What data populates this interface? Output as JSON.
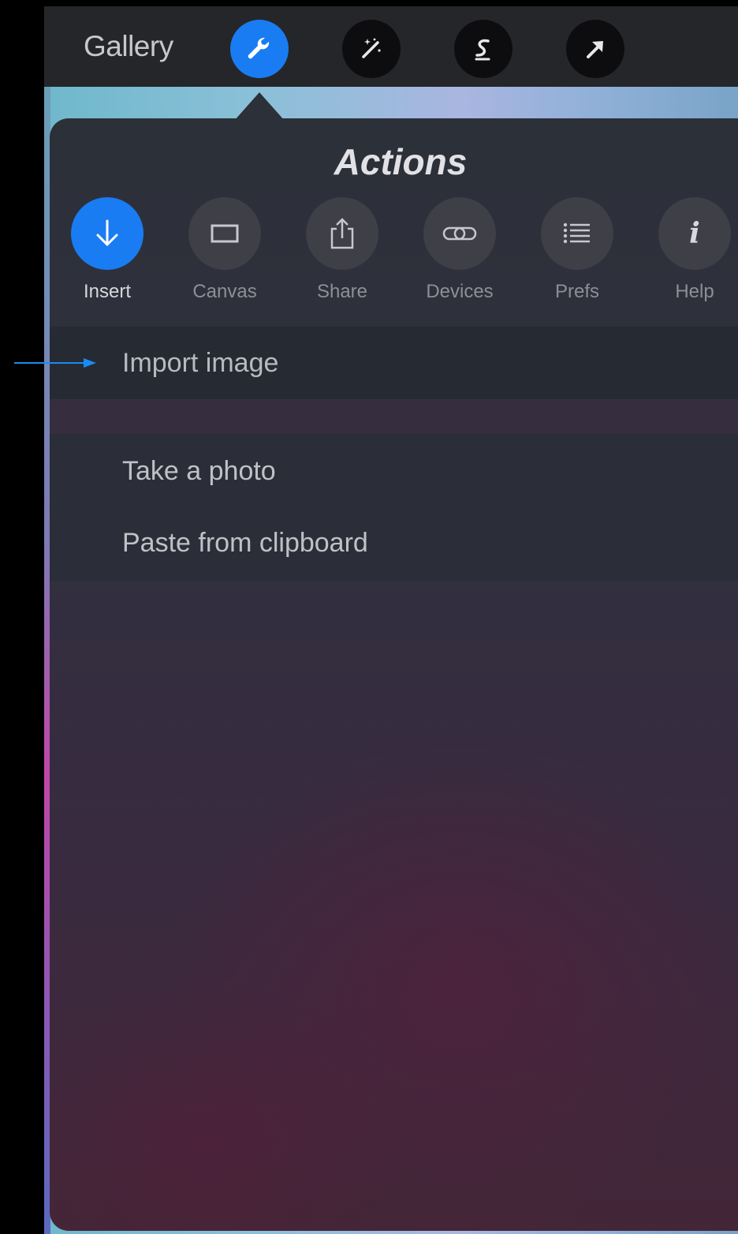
{
  "toolbar": {
    "gallery_label": "Gallery",
    "tools": [
      {
        "name": "wrench-icon",
        "active": true
      },
      {
        "name": "magic-wand-icon",
        "active": false
      },
      {
        "name": "selection-icon",
        "active": false
      },
      {
        "name": "transform-arrow-icon",
        "active": false
      }
    ]
  },
  "panel": {
    "title": "Actions",
    "categories": [
      {
        "label": "Insert",
        "icon": "insert-arrow-down-icon",
        "active": true
      },
      {
        "label": "Canvas",
        "icon": "canvas-rectangle-icon",
        "active": false
      },
      {
        "label": "Share",
        "icon": "share-icon",
        "active": false
      },
      {
        "label": "Devices",
        "icon": "link-icon",
        "active": false
      },
      {
        "label": "Prefs",
        "icon": "list-icon",
        "active": false
      },
      {
        "label": "Help",
        "icon": "info-icon",
        "active": false
      }
    ],
    "items": [
      {
        "label": "Import image"
      },
      {
        "label": "Take a photo"
      },
      {
        "label": "Paste from clipboard"
      }
    ]
  },
  "colors": {
    "accent": "#1a7cf2",
    "annotation_arrow": "#1a8cf0"
  }
}
